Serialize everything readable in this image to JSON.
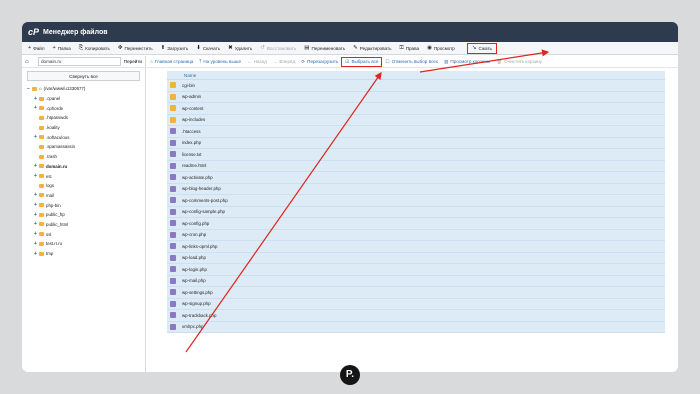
{
  "window": {
    "title": "Менеджер файлов",
    "logo": "cP"
  },
  "menubar": [
    {
      "name": "menu-file",
      "icon": "+",
      "label": "Файл",
      "disabled": false
    },
    {
      "name": "menu-folder",
      "icon": "+",
      "label": "Папка",
      "disabled": false
    },
    {
      "name": "menu-copy",
      "icon": "⎘",
      "label": "Копировать",
      "disabled": false
    },
    {
      "name": "menu-move",
      "icon": "✥",
      "label": "Переместить",
      "disabled": false
    },
    {
      "name": "menu-upload",
      "icon": "⬆",
      "label": "Загрузить",
      "disabled": false
    },
    {
      "name": "menu-download",
      "icon": "⬇",
      "label": "Скачать",
      "disabled": false
    },
    {
      "name": "menu-delete",
      "icon": "✖",
      "label": "Удалить",
      "disabled": false
    },
    {
      "name": "menu-restore",
      "icon": "↺",
      "label": "Восстановить",
      "disabled": true
    },
    {
      "name": "menu-rename",
      "icon": "▤",
      "label": "Переименовать",
      "disabled": false
    },
    {
      "name": "menu-edit",
      "icon": "✎",
      "label": "Редактировать",
      "disabled": false
    },
    {
      "name": "menu-permissions",
      "icon": "⚿",
      "label": "Права",
      "disabled": false
    },
    {
      "name": "menu-view",
      "icon": "◉",
      "label": "Просмотр",
      "disabled": false
    },
    {
      "name": "menu-extract",
      "icon": "",
      "label": "",
      "disabled": true
    },
    {
      "name": "menu-compress",
      "icon": "↘",
      "label": "Сжать",
      "disabled": false,
      "highlight": true
    }
  ],
  "sidebar": {
    "domain": "domain.ru",
    "go": "Перейти",
    "collapse": "Свернуть все",
    "tree": [
      {
        "label": "(/var/www/u1330577)",
        "pm": "−",
        "depth": 0,
        "home": true
      },
      {
        "label": ".cpanel",
        "pm": "+",
        "depth": 1
      },
      {
        "label": ".cphorde",
        "pm": "+",
        "depth": 1
      },
      {
        "label": ".htpasswds",
        "pm": "",
        "depth": 1
      },
      {
        "label": ".koality",
        "pm": "",
        "depth": 1
      },
      {
        "label": ".softaculous",
        "pm": "+",
        "depth": 1
      },
      {
        "label": ".spamassassin",
        "pm": "",
        "depth": 1
      },
      {
        "label": ".trash",
        "pm": "",
        "depth": 1
      },
      {
        "label": "domain.ru",
        "pm": "+",
        "depth": 1,
        "bold": true
      },
      {
        "label": "etc",
        "pm": "+",
        "depth": 1
      },
      {
        "label": "logs",
        "pm": "",
        "depth": 1
      },
      {
        "label": "mail",
        "pm": "+",
        "depth": 1
      },
      {
        "label": "php-bin",
        "pm": "+",
        "depth": 1
      },
      {
        "label": "public_ftp",
        "pm": "+",
        "depth": 1
      },
      {
        "label": "public_html",
        "pm": "+",
        "depth": 1
      },
      {
        "label": "ssl",
        "pm": "+",
        "depth": 1
      },
      {
        "label": "test.rr.ru",
        "pm": "+",
        "depth": 1
      },
      {
        "label": "tmp",
        "pm": "+",
        "depth": 1
      }
    ]
  },
  "toolbar2": [
    {
      "name": "home-page-button",
      "icon": "⌂",
      "label": "Главная страница",
      "disabled": false
    },
    {
      "name": "level-up-button",
      "icon": "⤒",
      "label": "На уровень выше",
      "disabled": false
    },
    {
      "name": "back-button",
      "icon": "←",
      "label": "Назад",
      "disabled": true
    },
    {
      "name": "forward-button",
      "icon": "→",
      "label": "Вперёд",
      "disabled": true
    },
    {
      "name": "reload-button",
      "icon": "⟳",
      "label": "Перезагрузить",
      "disabled": false
    },
    {
      "name": "select-all-button",
      "icon": "☑",
      "label": "Выбрать все",
      "disabled": false,
      "highlight": true
    },
    {
      "name": "deselect-all-button",
      "icon": "☐",
      "label": "Отменить выбор всех",
      "disabled": false
    },
    {
      "name": "view-trash-button",
      "icon": "▥",
      "label": "Просмотр корзины",
      "disabled": false
    },
    {
      "name": "empty-trash-button",
      "icon": "🗑",
      "label": "Очистить корзину",
      "disabled": true
    }
  ],
  "files": {
    "header": "Name",
    "rows": [
      {
        "name": "cgi-bin",
        "type": "folder"
      },
      {
        "name": "wp-admin",
        "type": "folder"
      },
      {
        "name": "wp-content",
        "type": "folder"
      },
      {
        "name": "wp-includes",
        "type": "folder"
      },
      {
        "name": ".htaccess",
        "type": "file"
      },
      {
        "name": "index.php",
        "type": "file"
      },
      {
        "name": "license.txt",
        "type": "file"
      },
      {
        "name": "readme.html",
        "type": "file"
      },
      {
        "name": "wp-activate.php",
        "type": "file"
      },
      {
        "name": "wp-blog-header.php",
        "type": "file"
      },
      {
        "name": "wp-comments-post.php",
        "type": "file"
      },
      {
        "name": "wp-config-sample.php",
        "type": "file"
      },
      {
        "name": "wp-config.php",
        "type": "file"
      },
      {
        "name": "wp-cron.php",
        "type": "file"
      },
      {
        "name": "wp-links-opml.php",
        "type": "file"
      },
      {
        "name": "wp-load.php",
        "type": "file"
      },
      {
        "name": "wp-login.php",
        "type": "file"
      },
      {
        "name": "wp-mail.php",
        "type": "file"
      },
      {
        "name": "wp-settings.php",
        "type": "file"
      },
      {
        "name": "wp-signup.php",
        "type": "file"
      },
      {
        "name": "wp-trackback.php",
        "type": "file"
      },
      {
        "name": "xmlrpc.php",
        "type": "file"
      }
    ]
  },
  "badge": "P.",
  "colors": {
    "highlight": "#e0241f",
    "titlebar": "#2e3a4d",
    "row": "#ddebf7"
  }
}
